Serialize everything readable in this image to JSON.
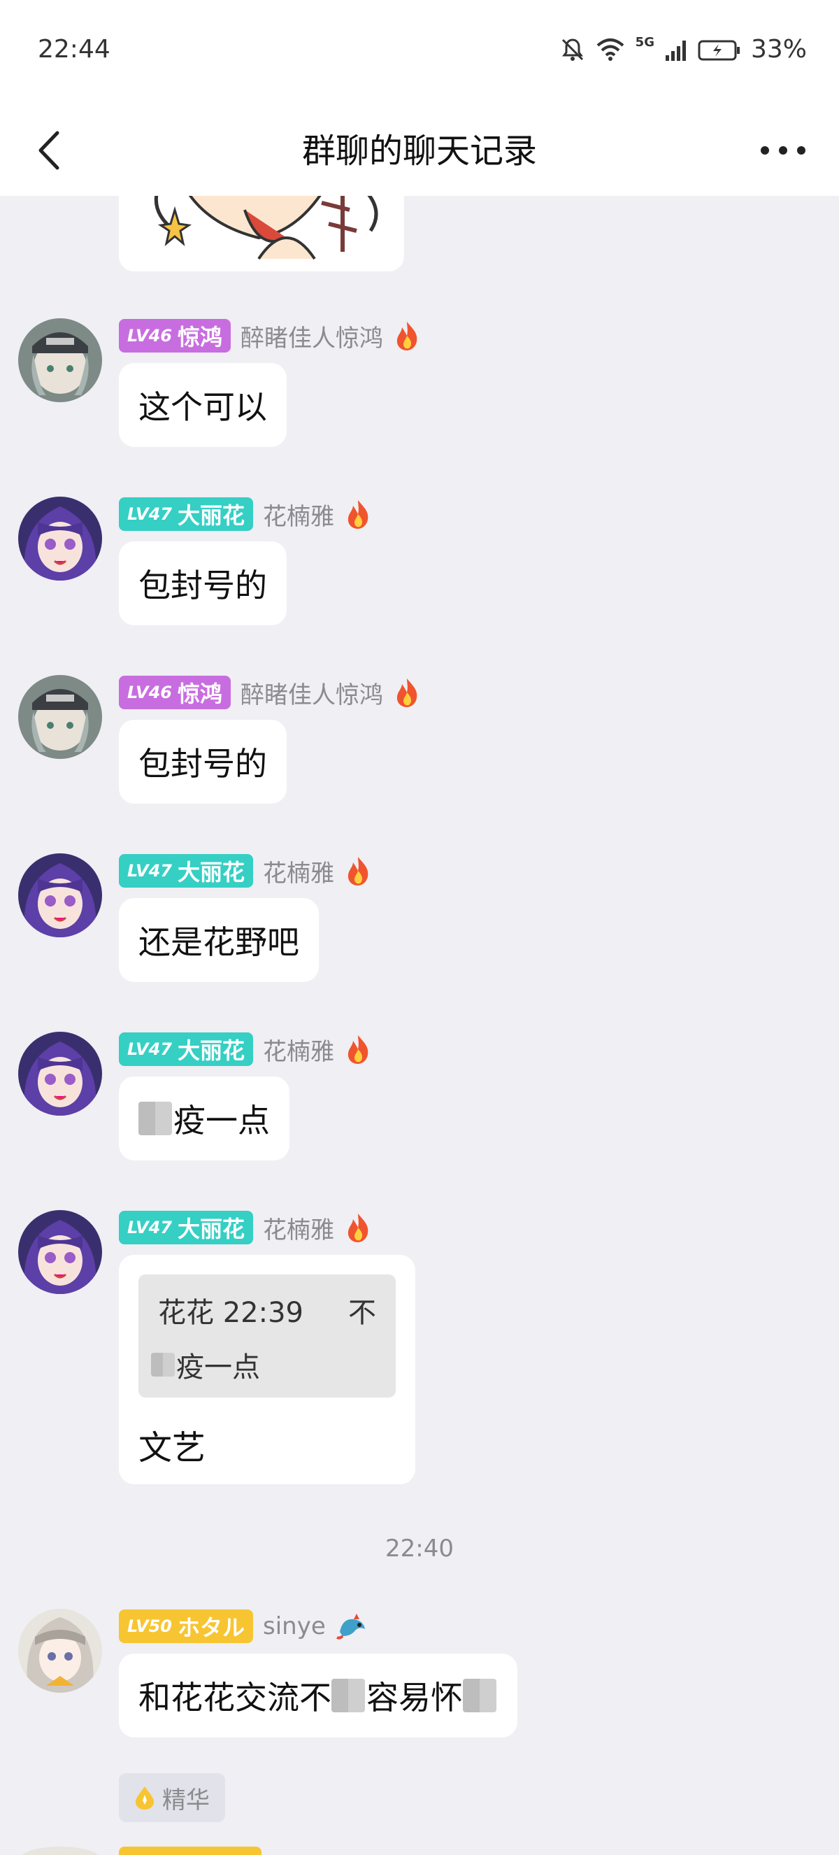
{
  "status_bar": {
    "time": "22:44",
    "network": "5G",
    "battery": "33%"
  },
  "nav": {
    "title": "群聊的聊天记录"
  },
  "messages": [
    {
      "badge_level": "LV46",
      "badge_title": "惊鸿",
      "nick": "醉睹佳人惊鸿",
      "text": "这个可以"
    },
    {
      "badge_level": "LV47",
      "badge_title": "大丽花",
      "nick": "花楠雅",
      "text": "包封号的"
    },
    {
      "badge_level": "LV46",
      "badge_title": "惊鸿",
      "nick": "醉睹佳人惊鸿",
      "text": "包封号的"
    },
    {
      "badge_level": "LV47",
      "badge_title": "大丽花",
      "nick": "花楠雅",
      "text": "还是花野吧"
    },
    {
      "badge_level": "LV47",
      "badge_title": "大丽花",
      "nick": "花楠雅",
      "text": "疫一点"
    },
    {
      "badge_level": "LV47",
      "badge_title": "大丽花",
      "nick": "花楠雅",
      "quote_author": "花花 22:39",
      "quote_tail": "不",
      "quote_text": "疫一点",
      "text": "文艺"
    },
    {
      "badge_level": "LV50",
      "badge_title": "ホタル",
      "nick": "sinye",
      "text_part1": "和花花交流不",
      "text_part2": "容易怀"
    }
  ],
  "timestamp": "22:40",
  "essence_tag": "精华",
  "colors": {
    "purple_badge": "#c86ddf",
    "teal_badge": "#35cfc4",
    "gold_badge": "#f7c531",
    "background": "#efeff4"
  }
}
